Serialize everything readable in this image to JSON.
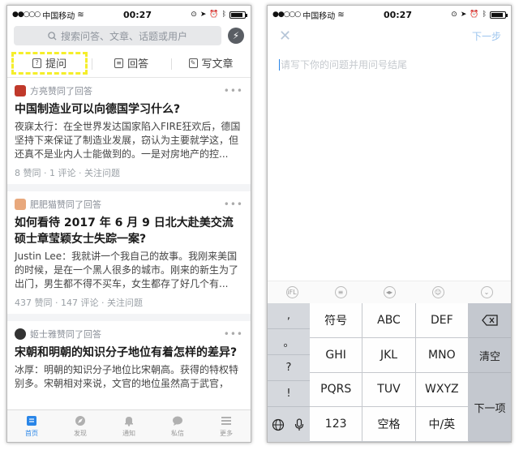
{
  "status": {
    "carrier": "中国移动",
    "time": "00:27",
    "battery_level": 0.9
  },
  "left": {
    "search": {
      "placeholder": "搜索问答、文章、话题或用户"
    },
    "actions": [
      {
        "label": "提问"
      },
      {
        "label": "回答"
      },
      {
        "label": "写文章"
      }
    ],
    "feed": [
      {
        "header": "方亮赞同了回答",
        "avatar_color": "#c0392b",
        "title": "中国制造业可以向德国学习什么?",
        "body": "夜寐太行：在全世界发达国家陷入FIRE狂欢后，德国坚持下来保证了制造业发展，窃认为主要就学这，但还真不是业内人士能做到的。一是对房地产的控...",
        "stats": "8 赞同 · 1 评论 · 关注问题"
      },
      {
        "header": "肥肥猫赞同了回答",
        "avatar_color": "#e8a87c",
        "title": "如何看待 2017 年 6 月 9 日北大赴美交流硕士章莹颖女士失踪一案?",
        "body": "Justin Lee：我就讲一个我自己的故事。我刚来美国的时候，是在一个黑人很多的城市。刚来的新生为了出门，男生都不得不买车，女生都存了好几个有...",
        "stats": "437 赞同 · 147 评论 · 关注问题"
      },
      {
        "header": "姬士雅赞同了回答",
        "avatar_color": "#333333",
        "title": "宋朝和明朝的知识分子地位有着怎样的差异?",
        "body": "冰厚：明朝的知识分子地位比宋朝高。获得的特权特别多。宋朝相对来说，文官的地位虽然高于武官，",
        "stats": ""
      }
    ],
    "tabs": [
      {
        "label": "首页",
        "icon": "home-icon",
        "active": true
      },
      {
        "label": "发现",
        "icon": "compass-icon",
        "active": false
      },
      {
        "label": "通知",
        "icon": "bell-icon",
        "active": false
      },
      {
        "label": "私信",
        "icon": "chat-icon",
        "active": false
      },
      {
        "label": "更多",
        "icon": "menu-icon",
        "active": false
      }
    ]
  },
  "right": {
    "next_label": "下一步",
    "question_placeholder": "请写下你的问题并用问号结尾",
    "keyboard": {
      "punct": [
        ",",
        "。",
        "?",
        "!"
      ],
      "keys": [
        "符号",
        "ABC",
        "DEF",
        "GHI",
        "JKL",
        "MNO",
        "PQRS",
        "TUV",
        "WXYZ",
        "123",
        "空格",
        "中/英"
      ],
      "clear_label": "清空",
      "next_label": "下一项"
    }
  }
}
